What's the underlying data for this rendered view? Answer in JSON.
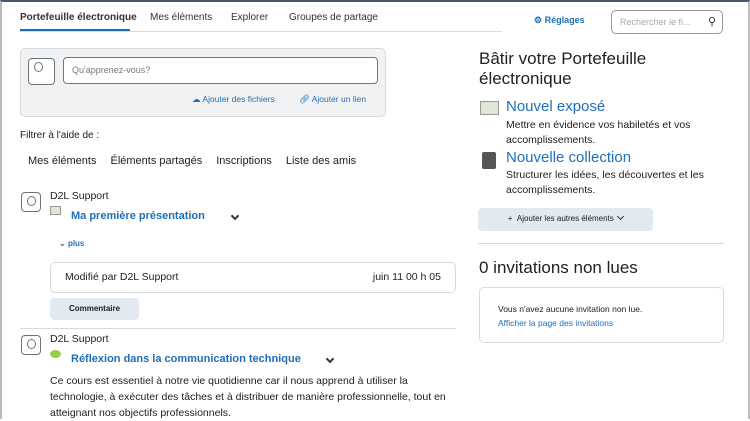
{
  "nav": {
    "tabs": [
      "Portefeuille électronique",
      "Mes éléments",
      "Explorer",
      "Groupes de partage"
    ],
    "settings": "Réglages",
    "search_placeholder": "Rechercher le fi..."
  },
  "composer": {
    "placeholder": "Qu'apprenez-vous?",
    "add_files": "Ajouter des fichiers",
    "add_link": "Ajouter un lien"
  },
  "filter": {
    "label": "Filtrer à l'aide de :",
    "options": [
      "Mes éléments",
      "Éléments partagés",
      "Inscriptions",
      "Liste des amis"
    ]
  },
  "feed": [
    {
      "author": "D2L Support",
      "title": "Ma première présentation",
      "more": "plus",
      "modified": "Modifié par D2L Support",
      "date": "juin 11 00 h 05",
      "comment": "Commentaire"
    },
    {
      "author": "D2L Support",
      "title": "Réflexion dans la communication technique",
      "body": "Ce cours est essentiel à notre vie quotidienne car il nous apprend à utiliser la technologie, à exécuter des tâches et à distribuer de manière professionnelle, tout en atteignant nos objectifs professionnels."
    }
  ],
  "build": {
    "title": "Bâtir votre Portefeuille électronique",
    "items": [
      {
        "title": "Nouvel exposé",
        "desc": "Mettre en évidence vos habiletés et vos accomplissements."
      },
      {
        "title": "Nouvelle collection",
        "desc": "Structurer les idées, les découvertes et les accomplissements."
      }
    ],
    "add_more": "Ajouter les autres éléments"
  },
  "invitations": {
    "title": "0 invitations non lues",
    "empty": "Vous n'avez aucune invitation non lue.",
    "link": "Afficher la page des invitations"
  }
}
